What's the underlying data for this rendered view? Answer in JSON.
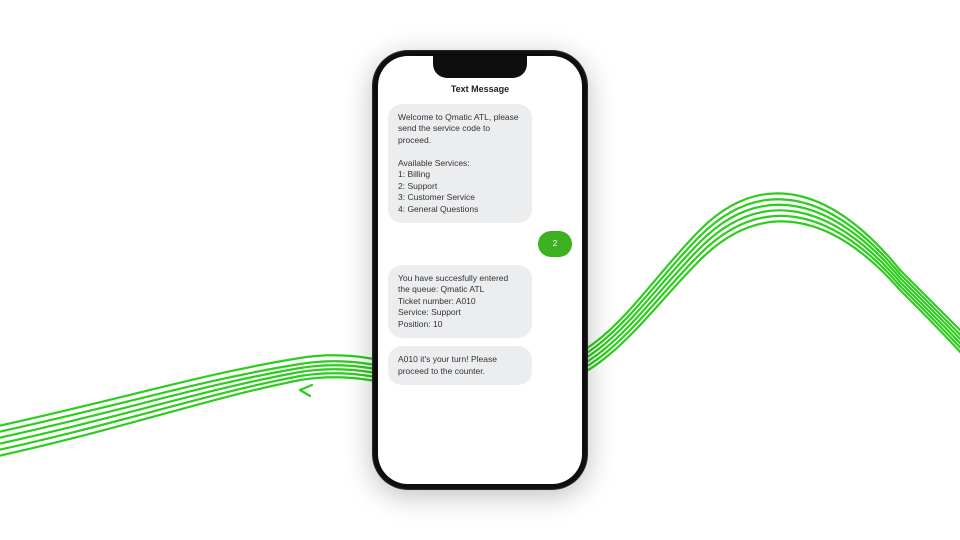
{
  "colors": {
    "accent_green": "#2ecc1e",
    "bubble_grey": "#ecedef",
    "bubble_green": "#3db120"
  },
  "phone": {
    "header": "Text Message"
  },
  "messages": [
    {
      "type": "incoming",
      "text": "Welcome to Qmatic ATL, please send the service code to proceed.\n\n Available Services:\n1: Billing\n2: Support\n3: Customer Service\n4: General Questions"
    },
    {
      "type": "outgoing",
      "text": "2"
    },
    {
      "type": "incoming",
      "text": "You have succesfully entered the queue: Qmatic ATL\nTicket number: A010\nService: Support\nPosition: 10"
    },
    {
      "type": "incoming",
      "text": "A010 it's your turn! Please proceed to the counter."
    }
  ]
}
